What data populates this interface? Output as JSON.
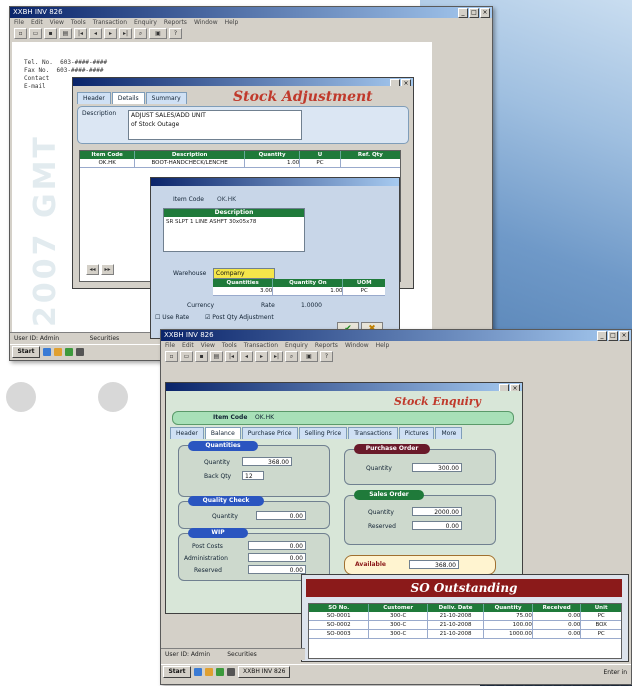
{
  "colors": {
    "titlebar": "#0a246a",
    "adjust_title": "#c0392b",
    "enquiry_title": "#c0392b",
    "grid_header": "#1f7a3a",
    "so_banner": "#8b1a1a"
  },
  "app_title_1": "XXBH INV 826",
  "app_title_2": "XXBH INV 826",
  "menu_items": [
    "File",
    "Edit",
    "View",
    "Tools",
    "Transaction",
    "Enquiry",
    "Reports",
    "Window",
    "Help"
  ],
  "address": {
    "tel_label": "Tel. No.",
    "tel_value": "603-####-####",
    "fax_label": "Fax No.",
    "fax_value": "603-####-####",
    "contact_label": "Contact",
    "email_label": "E-mail"
  },
  "stock_adjustment": {
    "title": "Stock Adjustment",
    "tabs": [
      "Header",
      "Details",
      "Summary"
    ],
    "description_label": "Description",
    "description_lines": [
      "ADJUST SALES/ADD UNIT",
      "of Stock Outage"
    ],
    "columns": [
      "Item Code",
      "Description",
      "Quantity",
      "U",
      "Ref. Qty"
    ],
    "row1": [
      "OK.HK",
      "BOOT-HANDCHECK/LENCHE",
      "1.00",
      "PC",
      ""
    ],
    "popup": {
      "item_code_label": "Item Code",
      "item_code_value": "OK.HK",
      "description_header": "Description",
      "description_value": "SR SLPT 1 LINE ASHFT 30x05x78",
      "warehouse_label": "Warehouse",
      "warehouse_value": "Company",
      "qty_headers": [
        "Quantities",
        "Quantity On",
        "UOM"
      ],
      "qty_values": [
        "3.00",
        "1.00",
        "PC"
      ],
      "currency_label": "Currency",
      "rate_label": "Rate",
      "rate_value": "1.0000",
      "checkbox1": "Use Rate",
      "checkbox2": "Post Qty Adjustment"
    }
  },
  "stock_enquiry": {
    "title": "Stock Enquiry",
    "item_code_label": "Item Code",
    "item_code_value": "OK.HK",
    "tabs": [
      "Header",
      "Balance",
      "Purchase Price",
      "Selling Price",
      "Transactions",
      "Pictures",
      "More"
    ],
    "quantities_label": "Quantities",
    "quantity_label": "Quantity",
    "quantity_value": "368.00",
    "back_qty_label": "Back Qty",
    "back_qty_value": "12",
    "quality_check_label": "Quality Check",
    "qc_quantity_value": "0.00",
    "wip_label": "WIP",
    "post_costs_label": "Post Costs",
    "post_costs_value": "0.00",
    "administration_label": "Administration",
    "administration_value": "0.00",
    "reserved_label": "Reserved",
    "reserved_value": "0.00",
    "purchase_order_label": "Purchase Order",
    "po_quantity_value": "300.00",
    "sales_order_label": "Sales Order",
    "so_quantity_value": "2000.00",
    "so_reserved_label": "Reserved",
    "so_reserved_value": "0.00",
    "available_label": "Available",
    "available_value": "368.00"
  },
  "so_outstanding": {
    "title": "SO Outstanding",
    "columns": [
      "SO No.",
      "Customer",
      "Deliv. Date",
      "Quantity",
      "Received",
      "Unit"
    ],
    "rows": [
      [
        "SO-0001",
        "300-C",
        "21-10-2008",
        "75.00",
        "0.00",
        "PC"
      ],
      [
        "SO-0002",
        "300-C",
        "21-10-2008",
        "100.00",
        "0.00",
        "BOX"
      ],
      [
        "SO-0003",
        "300-C",
        "21-10-2008",
        "1000.00",
        "0.00",
        "PC"
      ]
    ]
  },
  "status": {
    "user_label_1": "User ID",
    "user_value_1": "Admin",
    "security_label_1": "Securities",
    "user_label_2": "User ID",
    "user_value_2": "Admin",
    "security_label_2": "Securities",
    "clock": "Enter in"
  },
  "taskbar": {
    "start": "Start",
    "task_item": "XXBH INV 826"
  },
  "watermark": "2007 GMT"
}
